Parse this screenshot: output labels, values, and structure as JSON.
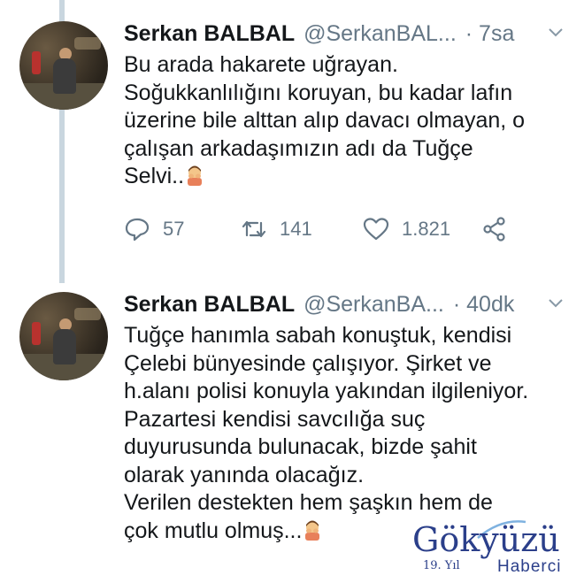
{
  "tweets": [
    {
      "name": "Serkan BALBAL",
      "handle": "@SerkanBAL...",
      "time": "· 7sa",
      "lines": [
        "Bu arada hakarete uğrayan.",
        "Soğukkanlılığını koruyan, bu kadar lafın",
        "üzerine bile alttan alıp davacı olmayan, o",
        "çalışan arkadaşımızın adı da Tuğçe",
        "Selvi.."
      ],
      "replies": "57",
      "retweets": "141",
      "likes": "1.821"
    },
    {
      "name": "Serkan BALBAL",
      "handle": "@SerkanBA...",
      "time": "· 40dk",
      "lines": [
        "Tuğçe hanımla sabah konuştuk, kendisi",
        "Çelebi bünyesinde çalışıyor. Şirket ve",
        "h.alanı polisi konuyla yakından ilgileniyor.",
        "Pazartesi kendisi savcılığa suç",
        "duyurusunda bulunacak, bizde şahit",
        "olarak yanında olacağız.",
        "Verilen destekten hem şaşkın hem de",
        "çok mutlu olmuş..."
      ]
    }
  ],
  "watermark": {
    "brand": "Gökyüzü",
    "sub": "Haberci",
    "year": "19. Yıl"
  },
  "icons": {
    "reply": "reply-icon",
    "retweet": "retweet-icon",
    "like": "heart-icon",
    "share": "share-icon",
    "caret": "chevron-down-icon",
    "emoji": "person-facepalming-emoji"
  },
  "colors": {
    "text": "#14171a",
    "muted": "#657786",
    "thread": "#c9d6df",
    "watermark": "#2b3f8a"
  }
}
